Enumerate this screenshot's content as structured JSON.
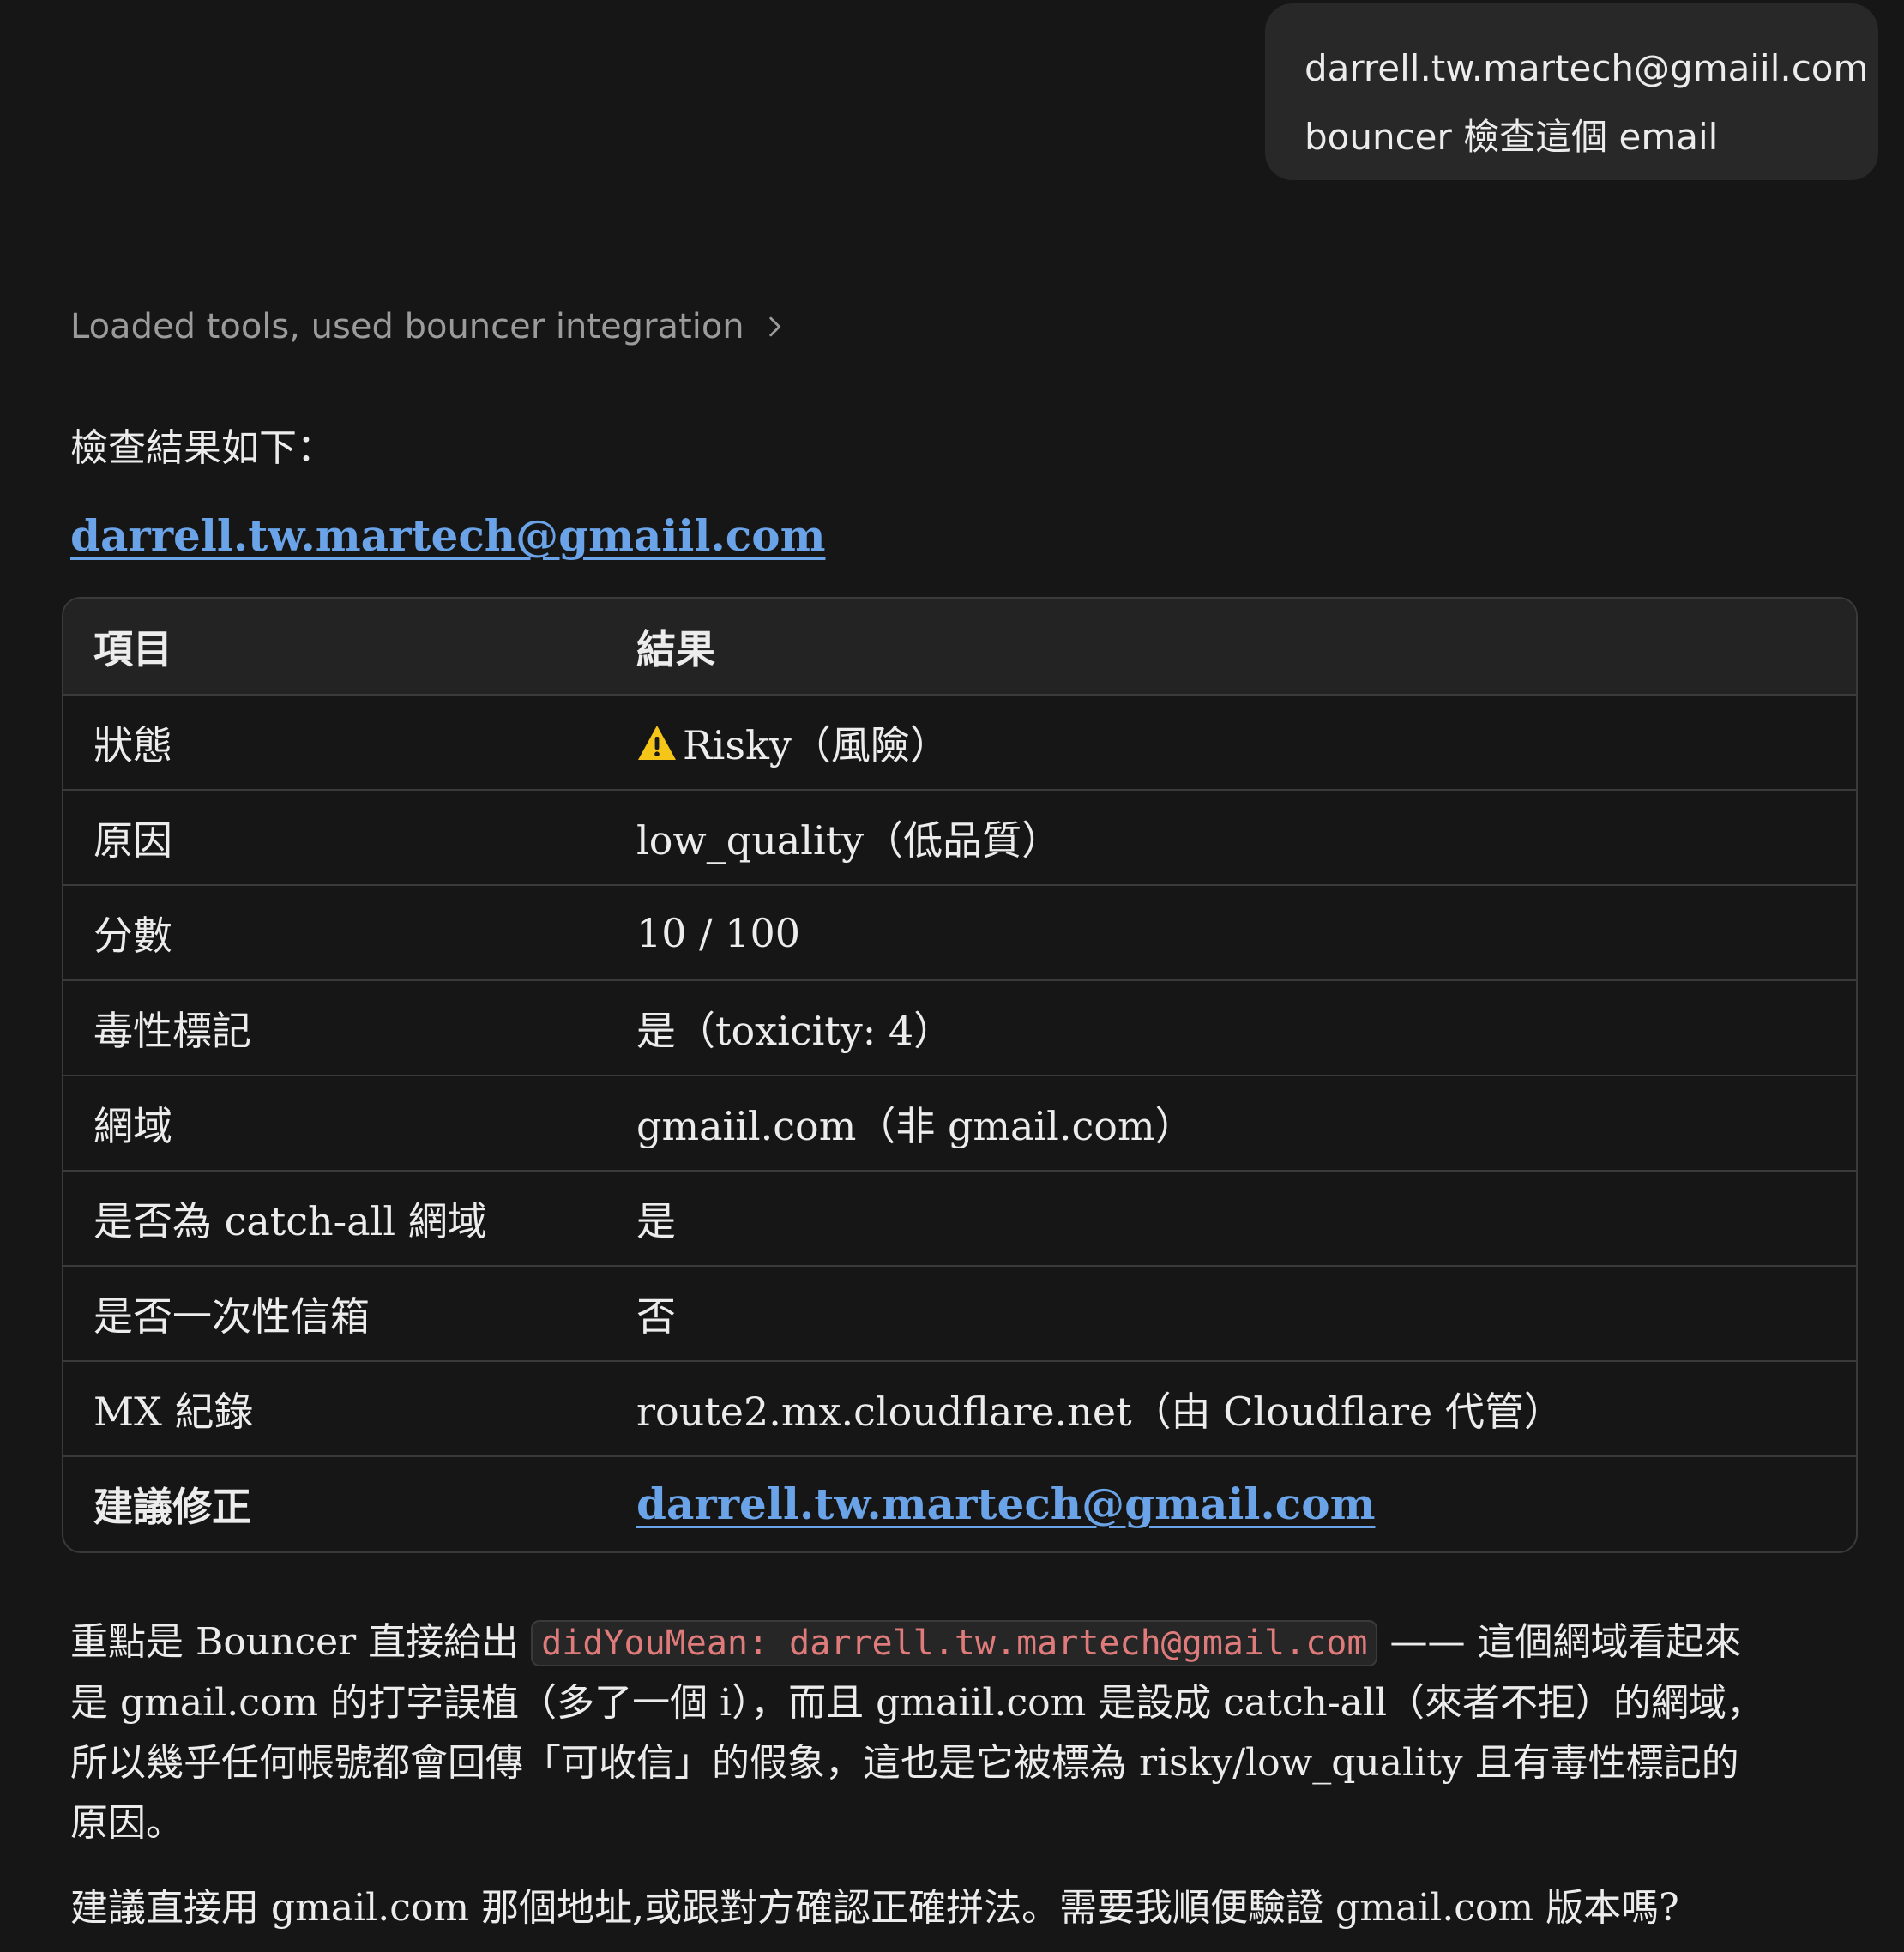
{
  "user_message": {
    "line1": "darrell.tw.martech@gmaiil.com",
    "line2": "bouncer 檢查這個 email"
  },
  "tools": {
    "summary": "Loaded tools, used bouncer integration",
    "chevron_icon": "chevron-right-icon"
  },
  "response": {
    "heading": "檢查結果如下：",
    "email": "darrell.tw.martech@gmaiil.com",
    "table": {
      "headers": [
        "項目",
        "結果"
      ],
      "rows": [
        {
          "label": "狀態",
          "value": "Risky（風險）",
          "icon": "warning-icon"
        },
        {
          "label": "原因",
          "value": "low_quality（低品質）"
        },
        {
          "label": "分數",
          "value": "10 / 100"
        },
        {
          "label": "毒性標記",
          "value": "是（toxicity: 4）"
        },
        {
          "label": "網域",
          "value": "gmaiil.com（非 gmail.com）"
        },
        {
          "label": "是否為 catch-all 網域",
          "value": "是"
        },
        {
          "label": "是否一次性信箱",
          "value": "否"
        },
        {
          "label": "MX 紀錄",
          "value": "route2.mx.cloudflare.net（由 Cloudflare 代管）"
        },
        {
          "label": "建議修正",
          "value": "darrell.tw.martech@gmail.com",
          "is_link": true
        }
      ]
    },
    "para1": {
      "prefix": "重點是 Bouncer 直接給出 ",
      "code": "didYouMean: darrell.tw.martech@gmail.com",
      "suffix": " —— 這個網域看起來",
      "line2": "是 gmail.com 的打字誤植（多了一個 i），而且 gmaiil.com 是設成 catch-all（來者不拒）的網域，",
      "line3": "所以幾乎任何帳號都會回傳「可收信」的假象，這也是它被標為 risky/low_quality 且有毒性標記的",
      "line4": "原因。"
    },
    "para2": "建議直接用 gmail.com 那個地址,或跟對方確認正確拼法。需要我順便驗證 gmail.com 版本嗎?"
  },
  "colors": {
    "background": "#161616",
    "bubble": "#282828",
    "link": "#6aa3e8",
    "code": "#e07b7b",
    "warning": "#f5c518"
  }
}
